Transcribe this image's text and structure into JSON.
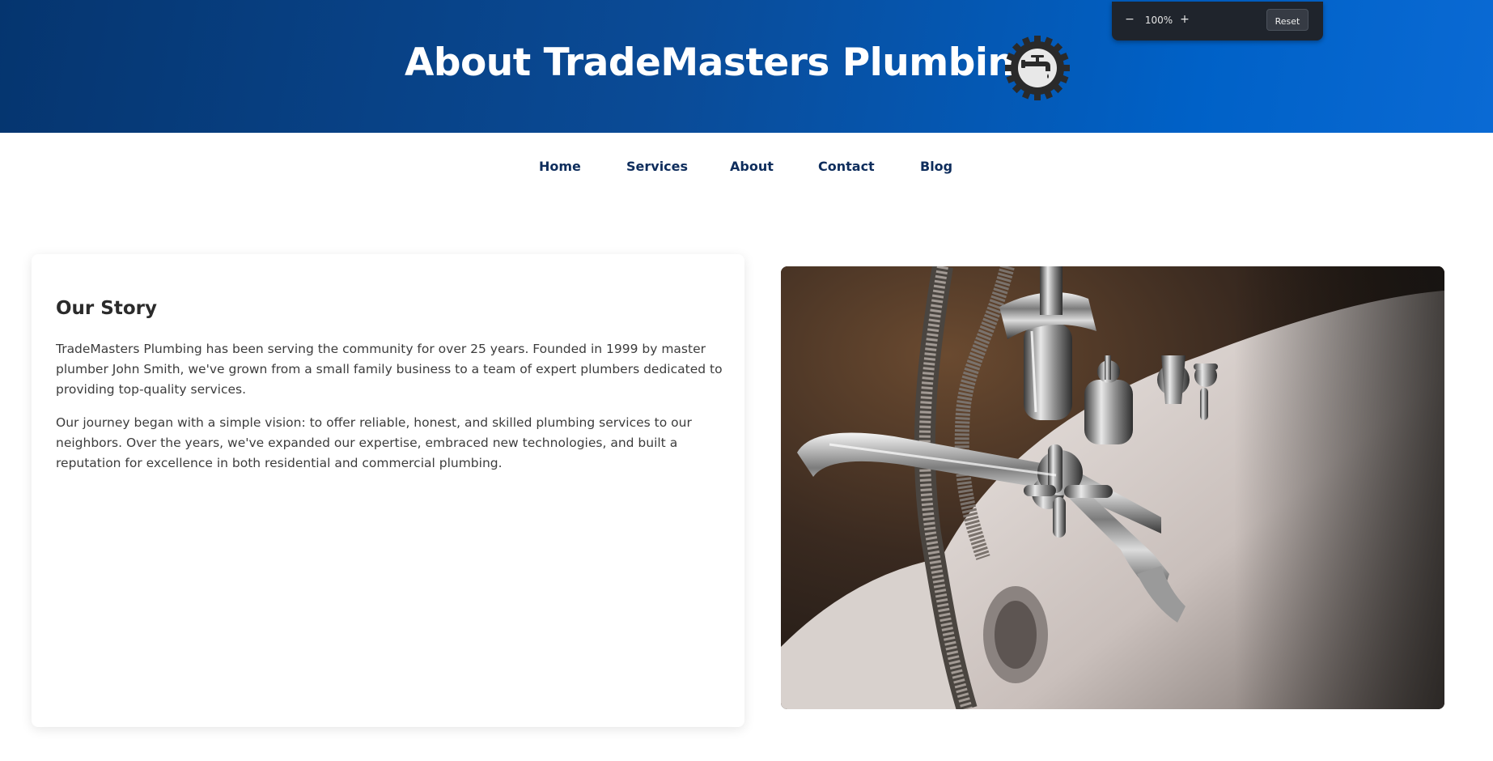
{
  "header": {
    "title": "About TradeMasters Plumbing",
    "logo_icon": "gear-faucet-icon",
    "gradient_colors": [
      "#05356f",
      "#0061c7"
    ]
  },
  "zoom": {
    "minus_label": "−",
    "level": "100%",
    "plus_label": "+",
    "reset_label": "Reset"
  },
  "nav": {
    "items": [
      {
        "label": "Home"
      },
      {
        "label": "Services"
      },
      {
        "label": "About"
      },
      {
        "label": "Contact"
      },
      {
        "label": "Blog"
      }
    ],
    "color": "#0e2d5c"
  },
  "story": {
    "title": "Our Story",
    "paragraphs": [
      "TradeMasters Plumbing has been serving the community for over 25 years. Founded in 1999 by master plumber John Smith, we've grown from a small family business to a team of expert plumbers dedicated to providing top-quality services.",
      "Our journey began with a simple vision: to offer reliable, honest, and skilled plumbing services to our neighbors. Over the years, we've expanded our expertise, embraced new technologies, and built a reputation for excellence in both residential and commercial plumbing."
    ]
  },
  "photo": {
    "subject": "chrome-bathtub-faucet-photo"
  }
}
